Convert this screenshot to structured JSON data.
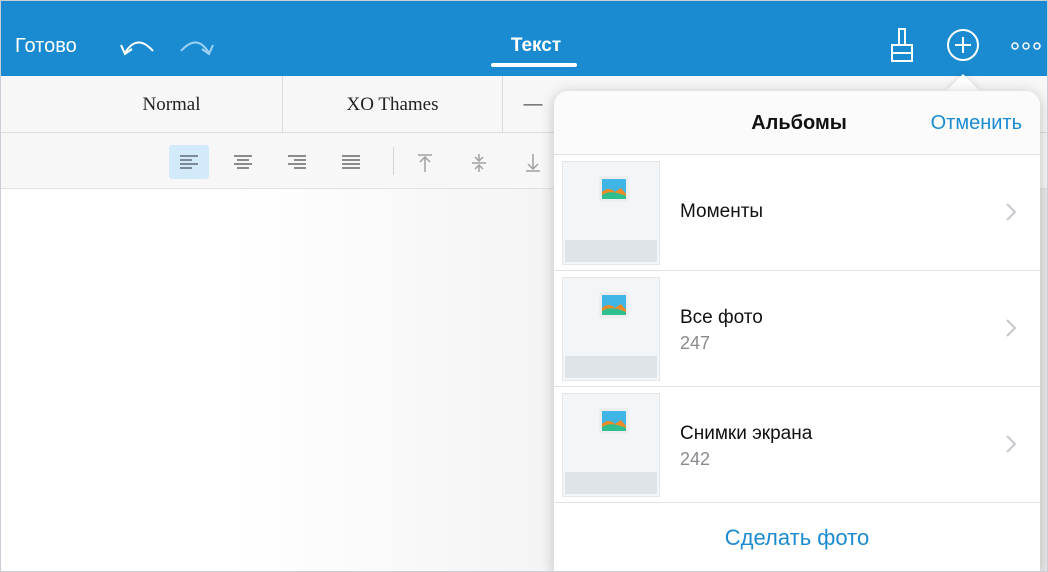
{
  "toolbar": {
    "done_label": "Готово",
    "active_tab": "Текст",
    "accent_color": "#1a8bd1"
  },
  "styles": {
    "items": [
      "Normal",
      "XO Thames",
      "—"
    ]
  },
  "alignment": {
    "buttons": [
      "align-left",
      "align-center",
      "align-right",
      "align-justify",
      "valign-top",
      "valign-middle",
      "valign-bottom"
    ],
    "active": "align-left"
  },
  "popover": {
    "title": "Альбомы",
    "cancel_label": "Отменить",
    "albums": [
      {
        "name": "Моменты",
        "count": ""
      },
      {
        "name": "Все фото",
        "count": "247"
      },
      {
        "name": "Снимки экрана",
        "count": "242"
      }
    ],
    "take_photo_label": "Сделать фото"
  }
}
